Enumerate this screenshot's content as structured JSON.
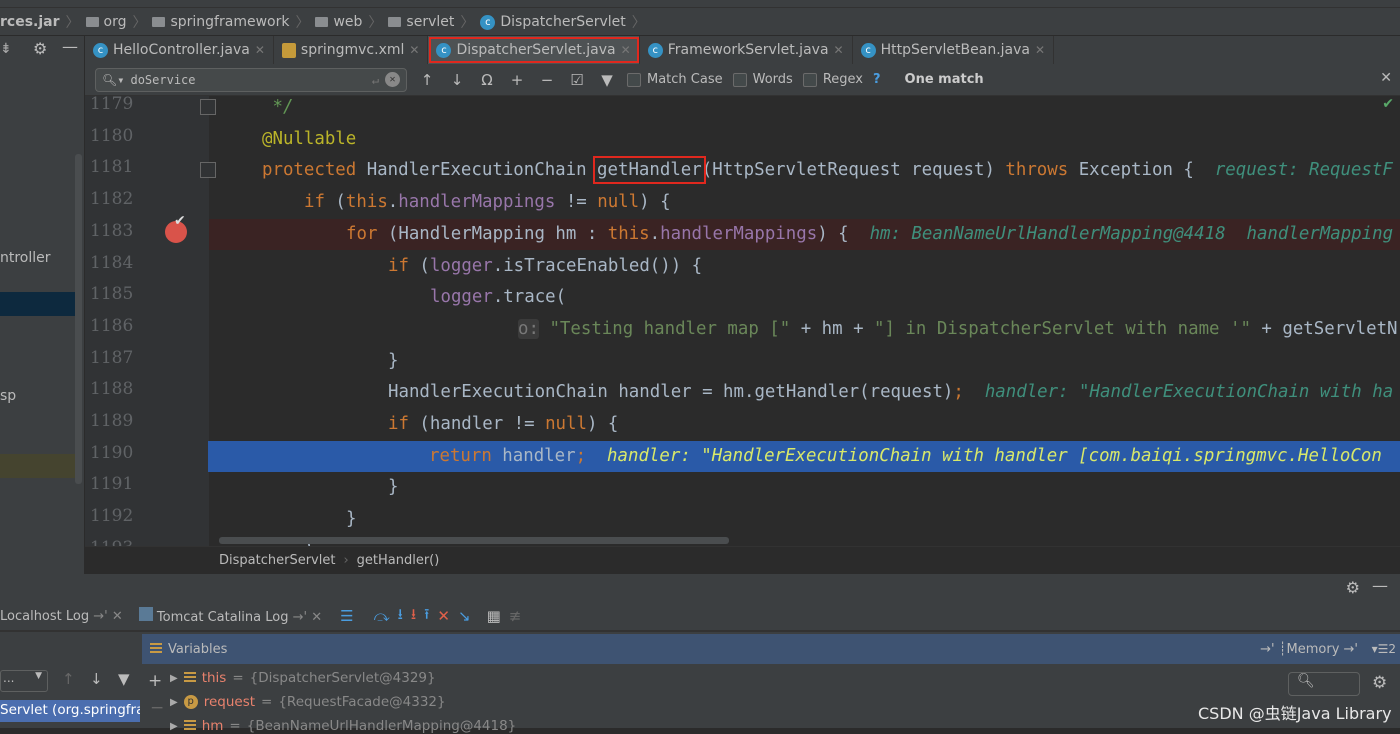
{
  "breadcrumbs": [
    "rces.jar",
    "org",
    "springframework",
    "web",
    "servlet",
    "DispatcherServlet"
  ],
  "tabs": [
    {
      "label": "HelloController.java",
      "icon": "class-icon"
    },
    {
      "label": "springmvc.xml",
      "icon": "xml-icon"
    },
    {
      "label": "DispatcherServlet.java",
      "icon": "class-icon",
      "active": true
    },
    {
      "label": "FrameworkServlet.java",
      "icon": "class-icon"
    },
    {
      "label": "HttpServletBean.java",
      "icon": "class-icon"
    }
  ],
  "find": {
    "query": "doService",
    "match_case": "Match Case",
    "words": "Words",
    "regex": "Regex",
    "help": "?",
    "result": "One match"
  },
  "left_panel": {
    "items": [
      "ntroller",
      "sp"
    ]
  },
  "code": {
    "lines": [
      {
        "n": "1179",
        "indent": 0,
        "tokens": [
          {
            "t": " */",
            "c": "cmt"
          }
        ]
      },
      {
        "n": "1180",
        "indent": 0,
        "tokens": [
          {
            "t": "@Nullable",
            "c": "ann"
          }
        ]
      },
      {
        "n": "1181",
        "indent": 0,
        "tokens": [
          {
            "t": "protected ",
            "c": "kw"
          },
          {
            "t": "HandlerExecutionChain "
          },
          {
            "t": "getHandler",
            "c": "boxed"
          },
          {
            "t": "(HttpServletRequest request) "
          },
          {
            "t": "throws ",
            "c": "kw"
          },
          {
            "t": "Exception {  "
          },
          {
            "t": "request: RequestF",
            "c": "hint"
          }
        ]
      },
      {
        "n": "1182",
        "indent": 1,
        "tokens": [
          {
            "t": "if ",
            "c": "kw"
          },
          {
            "t": "("
          },
          {
            "t": "this",
            "c": "kw"
          },
          {
            "t": "."
          },
          {
            "t": "handlerMappings",
            "c": "fld"
          },
          {
            "t": " != "
          },
          {
            "t": "null",
            "c": "kw"
          },
          {
            "t": ") {"
          }
        ]
      },
      {
        "n": "1183",
        "indent": 2,
        "bp": true,
        "tokens": [
          {
            "t": "for ",
            "c": "kw"
          },
          {
            "t": "(HandlerMapping hm : "
          },
          {
            "t": "this",
            "c": "kw"
          },
          {
            "t": "."
          },
          {
            "t": "handlerMappings",
            "c": "fld"
          },
          {
            "t": ") {  "
          },
          {
            "t": "hm: BeanNameUrlHandlerMapping@4418  handlerMapping",
            "c": "hint"
          }
        ]
      },
      {
        "n": "1184",
        "indent": 3,
        "tokens": [
          {
            "t": "if ",
            "c": "kw"
          },
          {
            "t": "("
          },
          {
            "t": "logger",
            "c": "fld"
          },
          {
            "t": ".isTraceEnabled()) {"
          }
        ]
      },
      {
        "n": "1185",
        "indent": 4,
        "tokens": [
          {
            "t": "logger",
            "c": "fld"
          },
          {
            "t": ".trace("
          }
        ]
      },
      {
        "n": "1186",
        "indent": 6,
        "tokens": [
          {
            "t": "o:",
            "c": "ph"
          },
          {
            "t": " "
          },
          {
            "t": "\"Testing handler map [\"",
            "c": "str"
          },
          {
            "t": " + hm + "
          },
          {
            "t": "\"] in DispatcherServlet with name '\"",
            "c": "str"
          },
          {
            "t": " + getServletN"
          }
        ]
      },
      {
        "n": "1187",
        "indent": 3,
        "tokens": [
          {
            "t": "}"
          }
        ]
      },
      {
        "n": "1188",
        "indent": 3,
        "tokens": [
          {
            "t": "HandlerExecutionChain handler = hm.getHandler(request)"
          },
          {
            "t": ";",
            "c": "kw"
          },
          {
            "t": "  "
          },
          {
            "t": "handler: \"HandlerExecutionChain with ha",
            "c": "hint"
          }
        ]
      },
      {
        "n": "1189",
        "indent": 3,
        "tokens": [
          {
            "t": "if ",
            "c": "kw"
          },
          {
            "t": "(handler != "
          },
          {
            "t": "null",
            "c": "kw"
          },
          {
            "t": ") {"
          }
        ]
      },
      {
        "n": "1190",
        "indent": 4,
        "cur": true,
        "tokens": [
          {
            "t": "return ",
            "c": "kw"
          },
          {
            "t": "handler"
          },
          {
            "t": ";",
            "c": "kw"
          },
          {
            "t": "  "
          },
          {
            "t": "handler: \"HandlerExecutionChain with handler [com.baiqi.springmvc.HelloCon",
            "c": "hint"
          }
        ]
      },
      {
        "n": "1191",
        "indent": 3,
        "tokens": [
          {
            "t": "}"
          }
        ]
      },
      {
        "n": "1192",
        "indent": 2,
        "tokens": [
          {
            "t": "}"
          }
        ]
      },
      {
        "n": "1193",
        "indent": 1,
        "tokens": [
          {
            "t": "}"
          }
        ]
      }
    ]
  },
  "editor_breadcrumb": {
    "class": "DispatcherServlet",
    "method": "getHandler()"
  },
  "debug": {
    "tabs": [
      "Localhost Log",
      "Tomcat Catalina Log"
    ],
    "variables_label": "Variables",
    "memory_label": "Memory",
    "count": "2",
    "frame": "Servlet (org.springfran",
    "frame_select": "...",
    "vars": [
      {
        "name": "this",
        "value": "{DispatcherServlet@4329}",
        "icon": "list-icon"
      },
      {
        "name": "request",
        "value": "{RequestFacade@4332}",
        "icon": "parameter-icon"
      },
      {
        "name": "hm",
        "value": "{BeanNameUrlHandlerMapping@4418}",
        "icon": "list-icon"
      }
    ]
  },
  "watermark": "CSDN @虫链Java Library",
  "colors": {
    "keyword": "#cc7832",
    "annotation": "#bbb529",
    "field": "#9876aa",
    "string": "#6a8759",
    "hint": "#3f8f7c",
    "current_line": "#2a5aa8",
    "breakpoint_line": "#3a2323",
    "highlight_box": "#e0281e"
  }
}
